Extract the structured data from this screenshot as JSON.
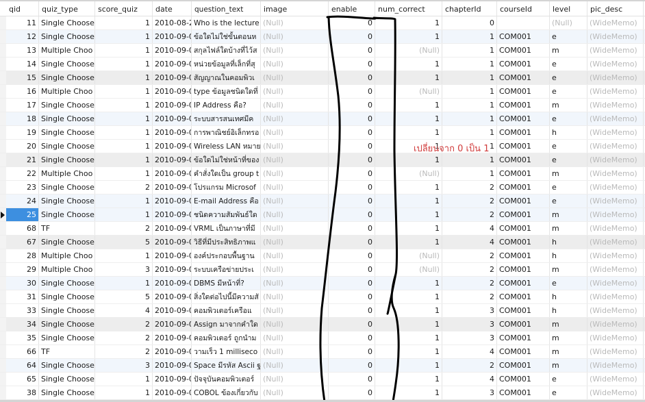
{
  "table": {
    "columns": [
      "qid",
      "quiz_type",
      "score_quiz",
      "date",
      "question_text",
      "image",
      "enable",
      "num_correct",
      "chapterId",
      "courseId",
      "level",
      "pic_desc"
    ],
    "selected_row_index": 14,
    "rows": [
      {
        "qid": "11",
        "quiz_type": "Single Choose",
        "score_quiz": "1",
        "date": "2010-08-2",
        "question_text": "Who is the lecture",
        "image": "(Null)",
        "enable": "0",
        "num_correct": "1",
        "chapterId": "0",
        "courseId": "",
        "level": "(Null)",
        "pic_desc": "(WideMemo)"
      },
      {
        "qid": "12",
        "quiz_type": "Single Choose",
        "score_quiz": "1",
        "date": "2010-09-0",
        "question_text": "ข้อใดไม่ใช่ขั้นตอนห",
        "image": "(Null)",
        "enable": "0",
        "num_correct": "1",
        "chapterId": "1",
        "courseId": "COM001",
        "level": "e",
        "pic_desc": "(WideMemo)"
      },
      {
        "qid": "13",
        "quiz_type": "Multiple Choo",
        "score_quiz": "1",
        "date": "2010-09-0",
        "question_text": "สกุลไฟล์ใดบ้างที่ไว้ส",
        "image": "(Null)",
        "enable": "0",
        "num_correct": "(Null)",
        "chapterId": "1",
        "courseId": "COM001",
        "level": "m",
        "pic_desc": "(WideMemo)"
      },
      {
        "qid": "14",
        "quiz_type": "Single Choose",
        "score_quiz": "1",
        "date": "2010-09-0",
        "question_text": "หน่วยข้อมูลที่เล็กที่สุ",
        "image": "(Null)",
        "enable": "0",
        "num_correct": "1",
        "chapterId": "1",
        "courseId": "COM001",
        "level": "e",
        "pic_desc": "(WideMemo)"
      },
      {
        "qid": "15",
        "quiz_type": "Single Choose",
        "score_quiz": "1",
        "date": "2010-09-0",
        "question_text": "สัญญาณในคอมพิวเ",
        "image": "(Null)",
        "enable": "0",
        "num_correct": "1",
        "chapterId": "1",
        "courseId": "COM001",
        "level": "e",
        "pic_desc": "(WideMemo)"
      },
      {
        "qid": "16",
        "quiz_type": "Multiple Choo",
        "score_quiz": "1",
        "date": "2010-09-0",
        "question_text": "type ข้อมูลชนิดใดที่",
        "image": "(Null)",
        "enable": "0",
        "num_correct": "(Null)",
        "chapterId": "1",
        "courseId": "COM001",
        "level": "e",
        "pic_desc": "(WideMemo)"
      },
      {
        "qid": "17",
        "quiz_type": "Single Choose",
        "score_quiz": "1",
        "date": "2010-09-0",
        "question_text": " IP Address คือ?",
        "image": "(Null)",
        "enable": "0",
        "num_correct": "1",
        "chapterId": "1",
        "courseId": "COM001",
        "level": "m",
        "pic_desc": "(WideMemo)"
      },
      {
        "qid": "18",
        "quiz_type": "Single Choose",
        "score_quiz": "1",
        "date": "2010-09-0",
        "question_text": "ระบบสารสนเทศมีค",
        "image": "(Null)",
        "enable": "0",
        "num_correct": "1",
        "chapterId": "1",
        "courseId": "COM001",
        "level": "e",
        "pic_desc": "(WideMemo)"
      },
      {
        "qid": "19",
        "quiz_type": "Single Choose",
        "score_quiz": "1",
        "date": "2010-09-0",
        "question_text": "การพาณิชย์อิเล็กทรอ",
        "image": "(Null)",
        "enable": "0",
        "num_correct": "1",
        "chapterId": "1",
        "courseId": "COM001",
        "level": "h",
        "pic_desc": "(WideMemo)"
      },
      {
        "qid": "20",
        "quiz_type": "Single Choose",
        "score_quiz": "1",
        "date": "2010-09-0",
        "question_text": "Wireless LAN หมาย",
        "image": "(Null)",
        "enable": "0",
        "num_correct": "1",
        "chapterId": "1",
        "courseId": "COM001",
        "level": "e",
        "pic_desc": "(WideMemo)"
      },
      {
        "qid": "21",
        "quiz_type": "Single Choose",
        "score_quiz": "1",
        "date": "2010-09-0",
        "question_text": "ข้อใดไม่ใช่หน้าที่ของ",
        "image": "(Null)",
        "enable": "0",
        "num_correct": "1",
        "chapterId": "1",
        "courseId": "COM001",
        "level": "e",
        "pic_desc": "(WideMemo)"
      },
      {
        "qid": "22",
        "quiz_type": "Multiple Choo",
        "score_quiz": "1",
        "date": "2010-09-0",
        "question_text": "คำสั่งใดเป็น group t",
        "image": "(Null)",
        "enable": "0",
        "num_correct": "(Null)",
        "chapterId": "1",
        "courseId": "COM001",
        "level": "m",
        "pic_desc": "(WideMemo)"
      },
      {
        "qid": "23",
        "quiz_type": "Single Choose",
        "score_quiz": "2",
        "date": "2010-09-0",
        "question_text": "โปรแกรม Microsof",
        "image": "(Null)",
        "enable": "0",
        "num_correct": "1",
        "chapterId": "2",
        "courseId": "COM001",
        "level": "e",
        "pic_desc": "(WideMemo)"
      },
      {
        "qid": "24",
        "quiz_type": "Single Choose",
        "score_quiz": "1",
        "date": "2010-09-0",
        "question_text": "E-mail Address คือ",
        "image": "(Null)",
        "enable": "0",
        "num_correct": "1",
        "chapterId": "2",
        "courseId": "COM001",
        "level": "e",
        "pic_desc": "(WideMemo)"
      },
      {
        "qid": "25",
        "quiz_type": "Single Choose",
        "score_quiz": "1",
        "date": "2010-09-0",
        "question_text": "ชนิดความสัมพันธ์ใด",
        "image": "(Null)",
        "enable": "0",
        "num_correct": "1",
        "chapterId": "2",
        "courseId": "COM001",
        "level": "m",
        "pic_desc": "(WideMemo)"
      },
      {
        "qid": "68",
        "quiz_type": "TF",
        "score_quiz": "2",
        "date": "2010-09-0",
        "question_text": "VRML เป็นภาษาที่มี",
        "image": "(Null)",
        "enable": "0",
        "num_correct": "1",
        "chapterId": "4",
        "courseId": "COM001",
        "level": "m",
        "pic_desc": "(WideMemo)"
      },
      {
        "qid": "67",
        "quiz_type": "Single Choose",
        "score_quiz": "5",
        "date": "2010-09-0",
        "question_text": "วิธีที่มีประสิทธิภาพแ",
        "image": "(Null)",
        "enable": "0",
        "num_correct": "1",
        "chapterId": "4",
        "courseId": "COM001",
        "level": "h",
        "pic_desc": "(WideMemo)"
      },
      {
        "qid": "28",
        "quiz_type": "Multiple Choo",
        "score_quiz": "1",
        "date": "2010-09-0",
        "question_text": "องค์ประกอบพื้นฐาน",
        "image": "(Null)",
        "enable": "0",
        "num_correct": "(Null)",
        "chapterId": "2",
        "courseId": "COM001",
        "level": "h",
        "pic_desc": "(WideMemo)"
      },
      {
        "qid": "29",
        "quiz_type": "Multiple Choo",
        "score_quiz": "3",
        "date": "2010-09-0",
        "question_text": "ระบบเครือข่ายประเ",
        "image": "(Null)",
        "enable": "0",
        "num_correct": "(Null)",
        "chapterId": "2",
        "courseId": "COM001",
        "level": "m",
        "pic_desc": "(WideMemo)"
      },
      {
        "qid": "30",
        "quiz_type": "Single Choose",
        "score_quiz": "1",
        "date": "2010-09-0",
        "question_text": "DBMS มีหน้าที่?",
        "image": "(Null)",
        "enable": "0",
        "num_correct": "1",
        "chapterId": "2",
        "courseId": "COM001",
        "level": "e",
        "pic_desc": "(WideMemo)"
      },
      {
        "qid": "31",
        "quiz_type": "Single Choose",
        "score_quiz": "5",
        "date": "2010-09-0",
        "question_text": "สิ่งใดต่อไปนี้มีความสั",
        "image": "(Null)",
        "enable": "0",
        "num_correct": "1",
        "chapterId": "2",
        "courseId": "COM001",
        "level": "h",
        "pic_desc": "(WideMemo)"
      },
      {
        "qid": "33",
        "quiz_type": "Single Choose",
        "score_quiz": "4",
        "date": "2010-09-0",
        "question_text": "คอมพิวเตอร์เครือแ",
        "image": "(Null)",
        "enable": "0",
        "num_correct": "1",
        "chapterId": "3",
        "courseId": "COM001",
        "level": "h",
        "pic_desc": "(WideMemo)"
      },
      {
        "qid": "34",
        "quiz_type": "Single Choose",
        "score_quiz": "2",
        "date": "2010-09-0",
        "question_text": "Assign มาจากคำใด",
        "image": "(Null)",
        "enable": "0",
        "num_correct": "1",
        "chapterId": "3",
        "courseId": "COM001",
        "level": "m",
        "pic_desc": "(WideMemo)"
      },
      {
        "qid": "35",
        "quiz_type": "Single Choose",
        "score_quiz": "2",
        "date": "2010-09-0",
        "question_text": "คอมพิวเตอร์ ถูกนำม",
        "image": "(Null)",
        "enable": "0",
        "num_correct": "1",
        "chapterId": "3",
        "courseId": "COM001",
        "level": "m",
        "pic_desc": "(WideMemo)"
      },
      {
        "qid": "66",
        "quiz_type": "TF",
        "score_quiz": "2",
        "date": "2010-09-0",
        "question_text": "วามเร็ว 1 milliseco",
        "image": "(Null)",
        "enable": "0",
        "num_correct": "1",
        "chapterId": "4",
        "courseId": "COM001",
        "level": "m",
        "pic_desc": "(WideMemo)"
      },
      {
        "qid": "64",
        "quiz_type": "Single Choose",
        "score_quiz": "3",
        "date": "2010-09-0",
        "question_text": "Space มีรหัส Ascii ฐ",
        "image": "(Null)",
        "enable": "0",
        "num_correct": "1",
        "chapterId": "2",
        "courseId": "COM001",
        "level": "m",
        "pic_desc": "(WideMemo)"
      },
      {
        "qid": "65",
        "quiz_type": "Single Choose",
        "score_quiz": "1",
        "date": "2010-09-0",
        "question_text": "ปัจจุบันคอมพิวเตอร์",
        "image": "(Null)",
        "enable": "0",
        "num_correct": "1",
        "chapterId": "4",
        "courseId": "COM001",
        "level": "e",
        "pic_desc": "(WideMemo)"
      },
      {
        "qid": "38",
        "quiz_type": "Single Choose",
        "score_quiz": "1",
        "date": "2010-09-0",
        "question_text": "COBOL ข้องเกี่ยวกับ",
        "image": "(Null)",
        "enable": "0",
        "num_correct": "1",
        "chapterId": "3",
        "courseId": "COM001",
        "level": "e",
        "pic_desc": "(WideMemo)"
      }
    ]
  },
  "annotation": {
    "note": "เปลี่ยนจาก  0 เป็น  1",
    "color": "#d03a3a"
  },
  "colors": {
    "selected": "#3d8fe0",
    "null_text": "#b9b9b9",
    "alt_blue": "#f1f6fc",
    "alt_gray": "#ededed"
  }
}
